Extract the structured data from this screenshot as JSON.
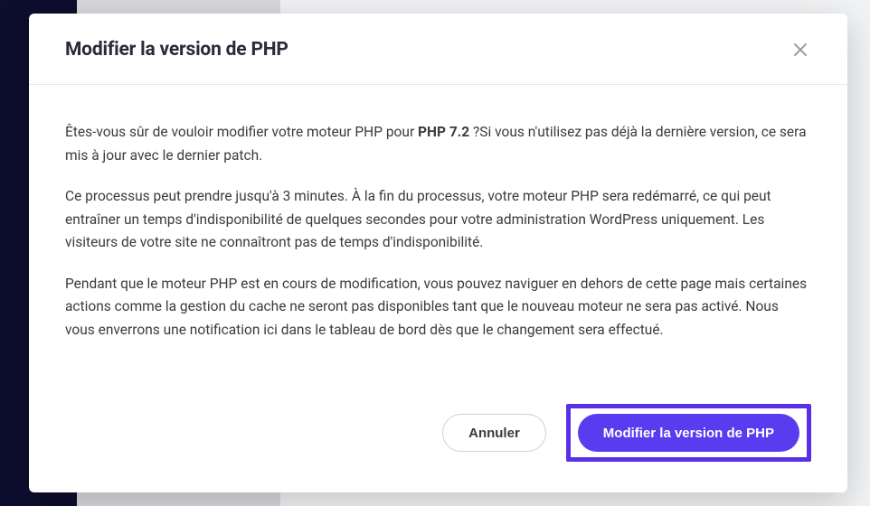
{
  "modal": {
    "title": "Modifier la version de PHP",
    "body": {
      "p1_prefix": "Êtes-vous sûr de vouloir modifier votre moteur PHP pour ",
      "p1_version": "PHP 7.2",
      "p1_suffix": " ?Si vous n'utilisez pas déjà la dernière version, ce sera mis à jour avec le dernier patch.",
      "p2": "Ce processus peut prendre jusqu'à 3 minutes. À la fin du processus, votre moteur PHP sera redémarré, ce qui peut entraîner un temps d'indisponibilité de quelques secondes pour votre administration WordPress uniquement. Les visiteurs de votre site ne connaîtront pas de temps d'indisponibilité.",
      "p3": "Pendant que le moteur PHP est en cours de modification, vous pouvez naviguer en dehors de cette page mais certaines actions comme la gestion du cache ne seront pas disponibles tant que le nouveau moteur ne sera pas activé. Nous vous enverrons une notification ici dans le tableau de bord dès que le changement sera effectué."
    },
    "buttons": {
      "cancel": "Annuler",
      "confirm": "Modifier la version de PHP"
    }
  }
}
